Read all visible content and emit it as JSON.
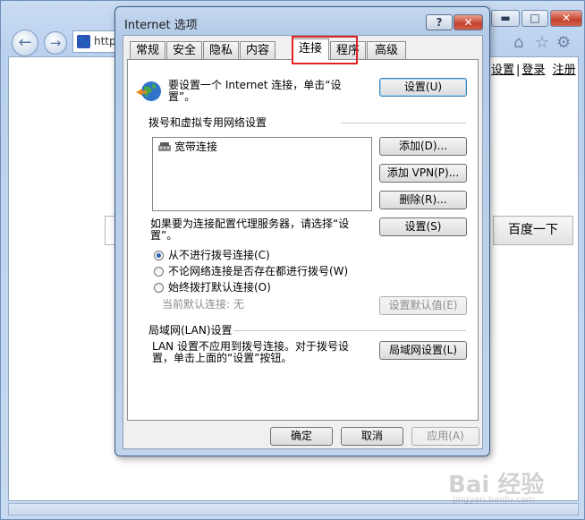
{
  "ie": {
    "address_text": "http",
    "links": [
      "设置",
      "登录",
      "注册"
    ],
    "search_button": "百度一下",
    "watermark": "Bai 经验",
    "watermark_sub": "jingyan.baidu.com"
  },
  "dialog": {
    "title": "Internet 选项",
    "help_label": "?",
    "close_label": "✕",
    "tabs": [
      "常规",
      "安全",
      "隐私",
      "内容",
      "连接",
      "程序",
      "高级"
    ],
    "active_tab": "连接",
    "setup_text_1": "要设置一个 Internet 连接，单击“设",
    "setup_text_2": "置”。",
    "setup_button": "设置(U)",
    "dialup_heading": "拨号和虚拟专用网络设置",
    "connections": [
      "宽带连接"
    ],
    "add_button": "添加(D)...",
    "add_vpn_button": "添加 VPN(P)...",
    "remove_button": "删除(R)...",
    "proxy_text_1": "如果要为连接配置代理服务器，请选择“设",
    "proxy_text_2": "置”。",
    "settings_button": "设置(S)",
    "radio_never": "从不进行拨号连接(C)",
    "radio_when_no_network": "不论网络连接是否存在都进行拨号(W)",
    "radio_always": "始终拨打默认连接(O)",
    "current_default": "当前默认连接: 无",
    "set_default_button": "设置默认值(E)",
    "lan_heading": "局域网(LAN)设置",
    "lan_text_1": "LAN 设置不应用到拨号连接。对于拨号设",
    "lan_text_2": "置，单击上面的“设置”按钮。",
    "lan_button": "局域网设置(L)",
    "ok_button": "确定",
    "cancel_button": "取消",
    "apply_button": "应用(A)"
  }
}
